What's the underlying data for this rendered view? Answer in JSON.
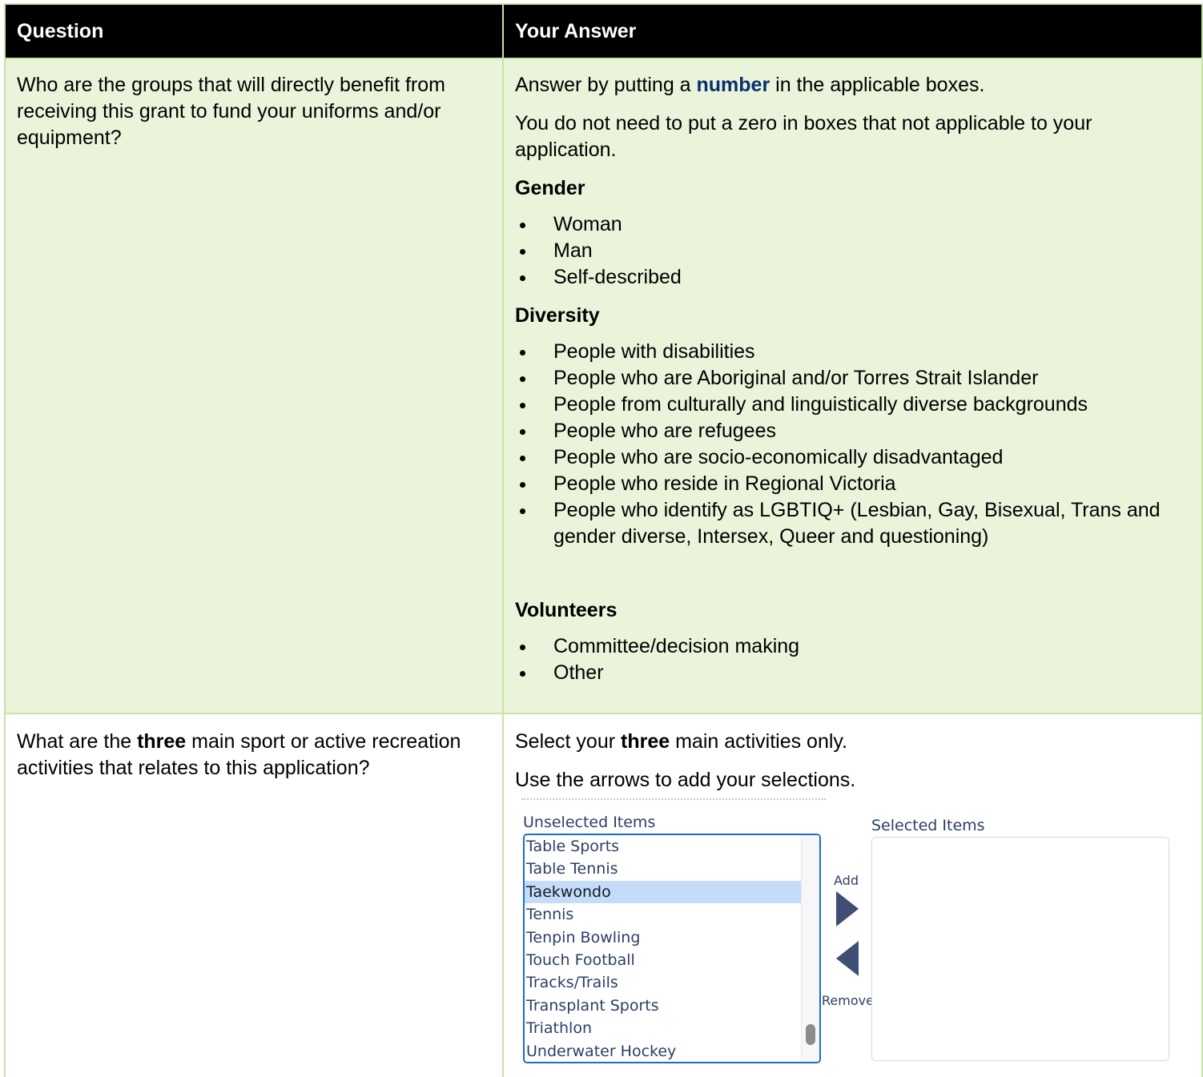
{
  "table": {
    "header": {
      "question": "Question",
      "answer": "Your Answer"
    },
    "row1": {
      "question": "Who are the groups that will directly benefit from receiving this grant to fund your uniforms and/or equipment?",
      "answer": {
        "intro_before": "Answer by putting a ",
        "intro_emph": "number",
        "intro_after": " in the applicable boxes.",
        "note": "You do not need to put a zero in boxes that not applicable to your application.",
        "gender_heading": "Gender",
        "gender_items": [
          "Woman",
          "Man",
          "Self-described"
        ],
        "diversity_heading": "Diversity",
        "diversity_items": [
          "People with disabilities",
          "People who are Aboriginal and/or Torres Strait Islander",
          "People from culturally and linguistically diverse backgrounds",
          "People who are refugees",
          "People who are socio-economically disadvantaged",
          "People who reside in Regional Victoria",
          "People who identify as LGBTIQ+ (Lesbian, Gay, Bisexual, Trans and gender diverse, Intersex, Queer and questioning)"
        ],
        "volunteers_heading": "Volunteers",
        "volunteers_items": [
          "Committee/decision making",
          "Other"
        ]
      }
    },
    "row2": {
      "question_before": "What are the ",
      "question_emph": "three",
      "question_after": " main sport or active recreation activities that relates to this application?",
      "answer": {
        "line1_before": "Select your ",
        "line1_emph": "three",
        "line1_after": " main activities only.",
        "line2": "Use the arrows to add your selections."
      }
    }
  },
  "dual_listbox": {
    "unselected_label": "Unselected Items",
    "selected_label": "Selected Items",
    "add_label": "Add",
    "remove_label": "Remove",
    "unselected_items": [
      "Table Sports",
      "Table Tennis",
      "Taekwondo",
      "Tennis",
      "Tenpin Bowling",
      "Touch Football",
      "Tracks/Trails",
      "Transplant Sports",
      "Triathlon",
      "Underwater Hockey"
    ],
    "highlighted_item": "Taekwondo",
    "selected_items": [],
    "colors": {
      "focus_border": "#1b6ad6",
      "highlight_bg": "#c4dcf8",
      "arrow": "#3e4f73"
    },
    "icons": {
      "add": "triangle-right-icon",
      "remove": "triangle-left-icon"
    }
  },
  "colors": {
    "header_bg": "#000000",
    "row_bg_green": "#eaf4da",
    "border": "#c8e3a8",
    "emph_blue": "#0b2e6e"
  }
}
